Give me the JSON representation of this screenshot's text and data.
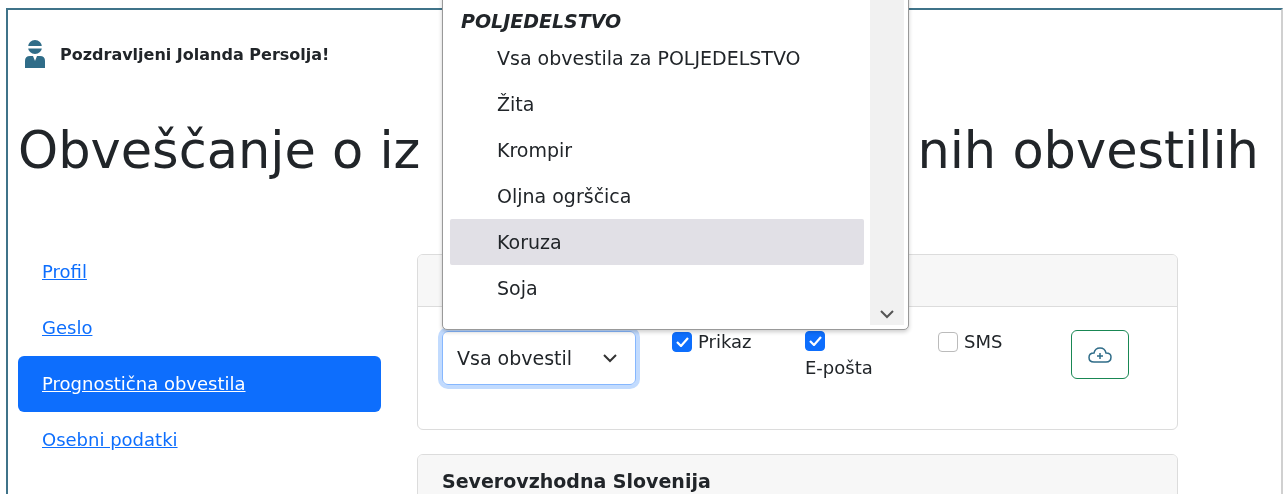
{
  "header": {
    "greeting": "Pozdravljeni Jolanda Persolja!"
  },
  "heading_parts": [
    "Obveščanje o iz",
    "nih obvestilih"
  ],
  "sidebar": {
    "items": [
      {
        "label": "Profil",
        "selected": false
      },
      {
        "label": "Geslo",
        "selected": false
      },
      {
        "label": "Prognostična obvestila",
        "selected": true
      },
      {
        "label": "Osebni podatki",
        "selected": false
      }
    ]
  },
  "subscription": {
    "select": {
      "value": "Vsa obvestil"
    },
    "checkboxes": [
      {
        "label": "Prikaz",
        "checked": true
      },
      {
        "label": "E-pošta",
        "checked": true
      },
      {
        "label": "SMS",
        "checked": false
      }
    ]
  },
  "dropdown": {
    "group": "POLJEDELSTVO",
    "options": [
      {
        "label": "Vsa obvestila za POLJEDELSTVO",
        "selected": false
      },
      {
        "label": "Žita",
        "selected": false
      },
      {
        "label": "Krompir",
        "selected": false
      },
      {
        "label": "Oljna ogrščica",
        "selected": false
      },
      {
        "label": "Koruza",
        "selected": true
      },
      {
        "label": "Soja",
        "selected": false
      }
    ]
  },
  "region_card": {
    "title": "Severovzhodna Slovenija"
  }
}
